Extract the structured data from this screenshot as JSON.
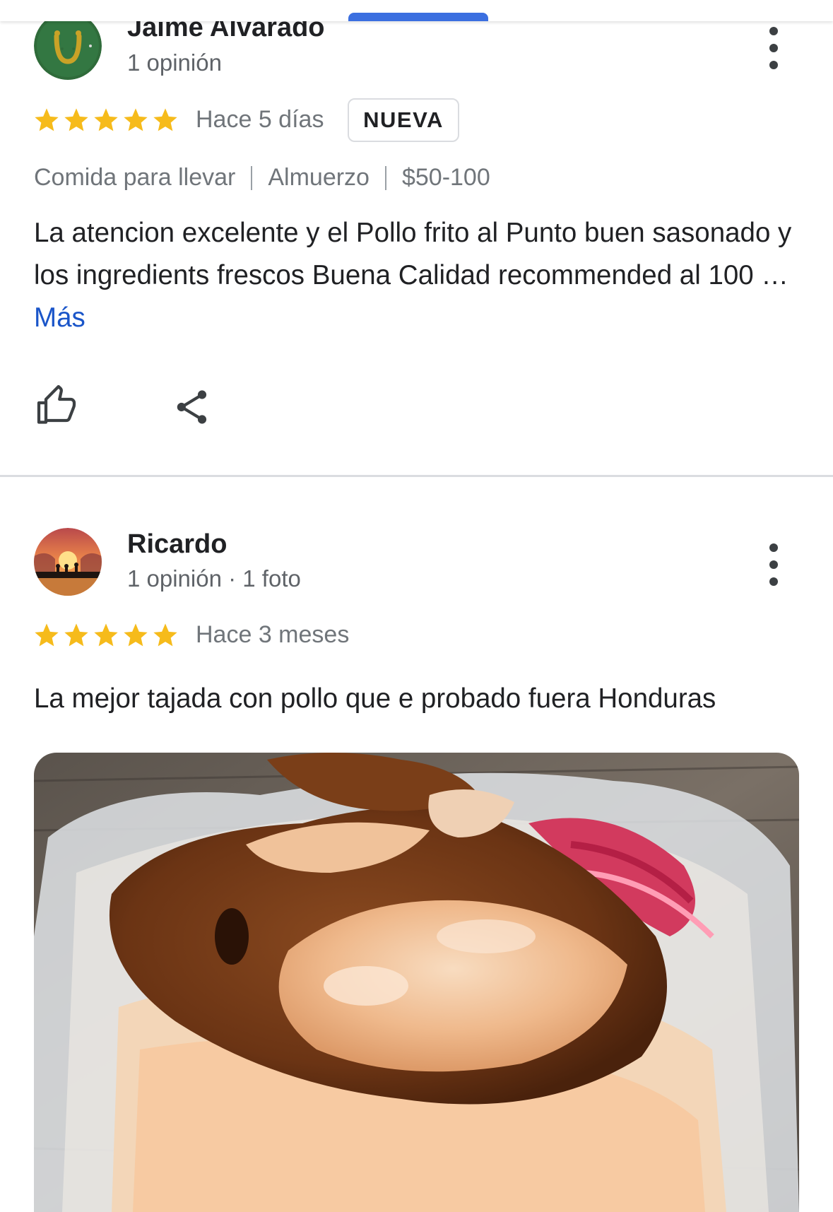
{
  "reviews": [
    {
      "author": "Jaime Alvarado",
      "subtitle": "1 opinión",
      "rating": 5,
      "time": "Hace 5 días",
      "badge": "NUEVA",
      "meta": [
        "Comida para llevar",
        "Almuerzo",
        "$50-100"
      ],
      "text": "La atencion excelente y el Pollo frito al Punto buen sasonado y los ingredients frescos Buena Calidad recommended al 100 … ",
      "more_label": "Más",
      "avatar_icon": "horseshoe-icon"
    },
    {
      "author": "Ricardo",
      "subtitle": "1 opinión · 1 foto",
      "rating": 5,
      "time": "Hace 3 meses",
      "text": "La mejor tajada con pollo que e probado fuera Honduras",
      "avatar_icon": "sunset-silhouette-icon"
    }
  ],
  "colors": {
    "star": "#f6bb1b",
    "link": "#1a55c9",
    "tab_indicator": "#3b6fe0"
  },
  "icons": [
    "more-vert-icon",
    "thumb-up-icon",
    "share-icon",
    "star-icon"
  ]
}
